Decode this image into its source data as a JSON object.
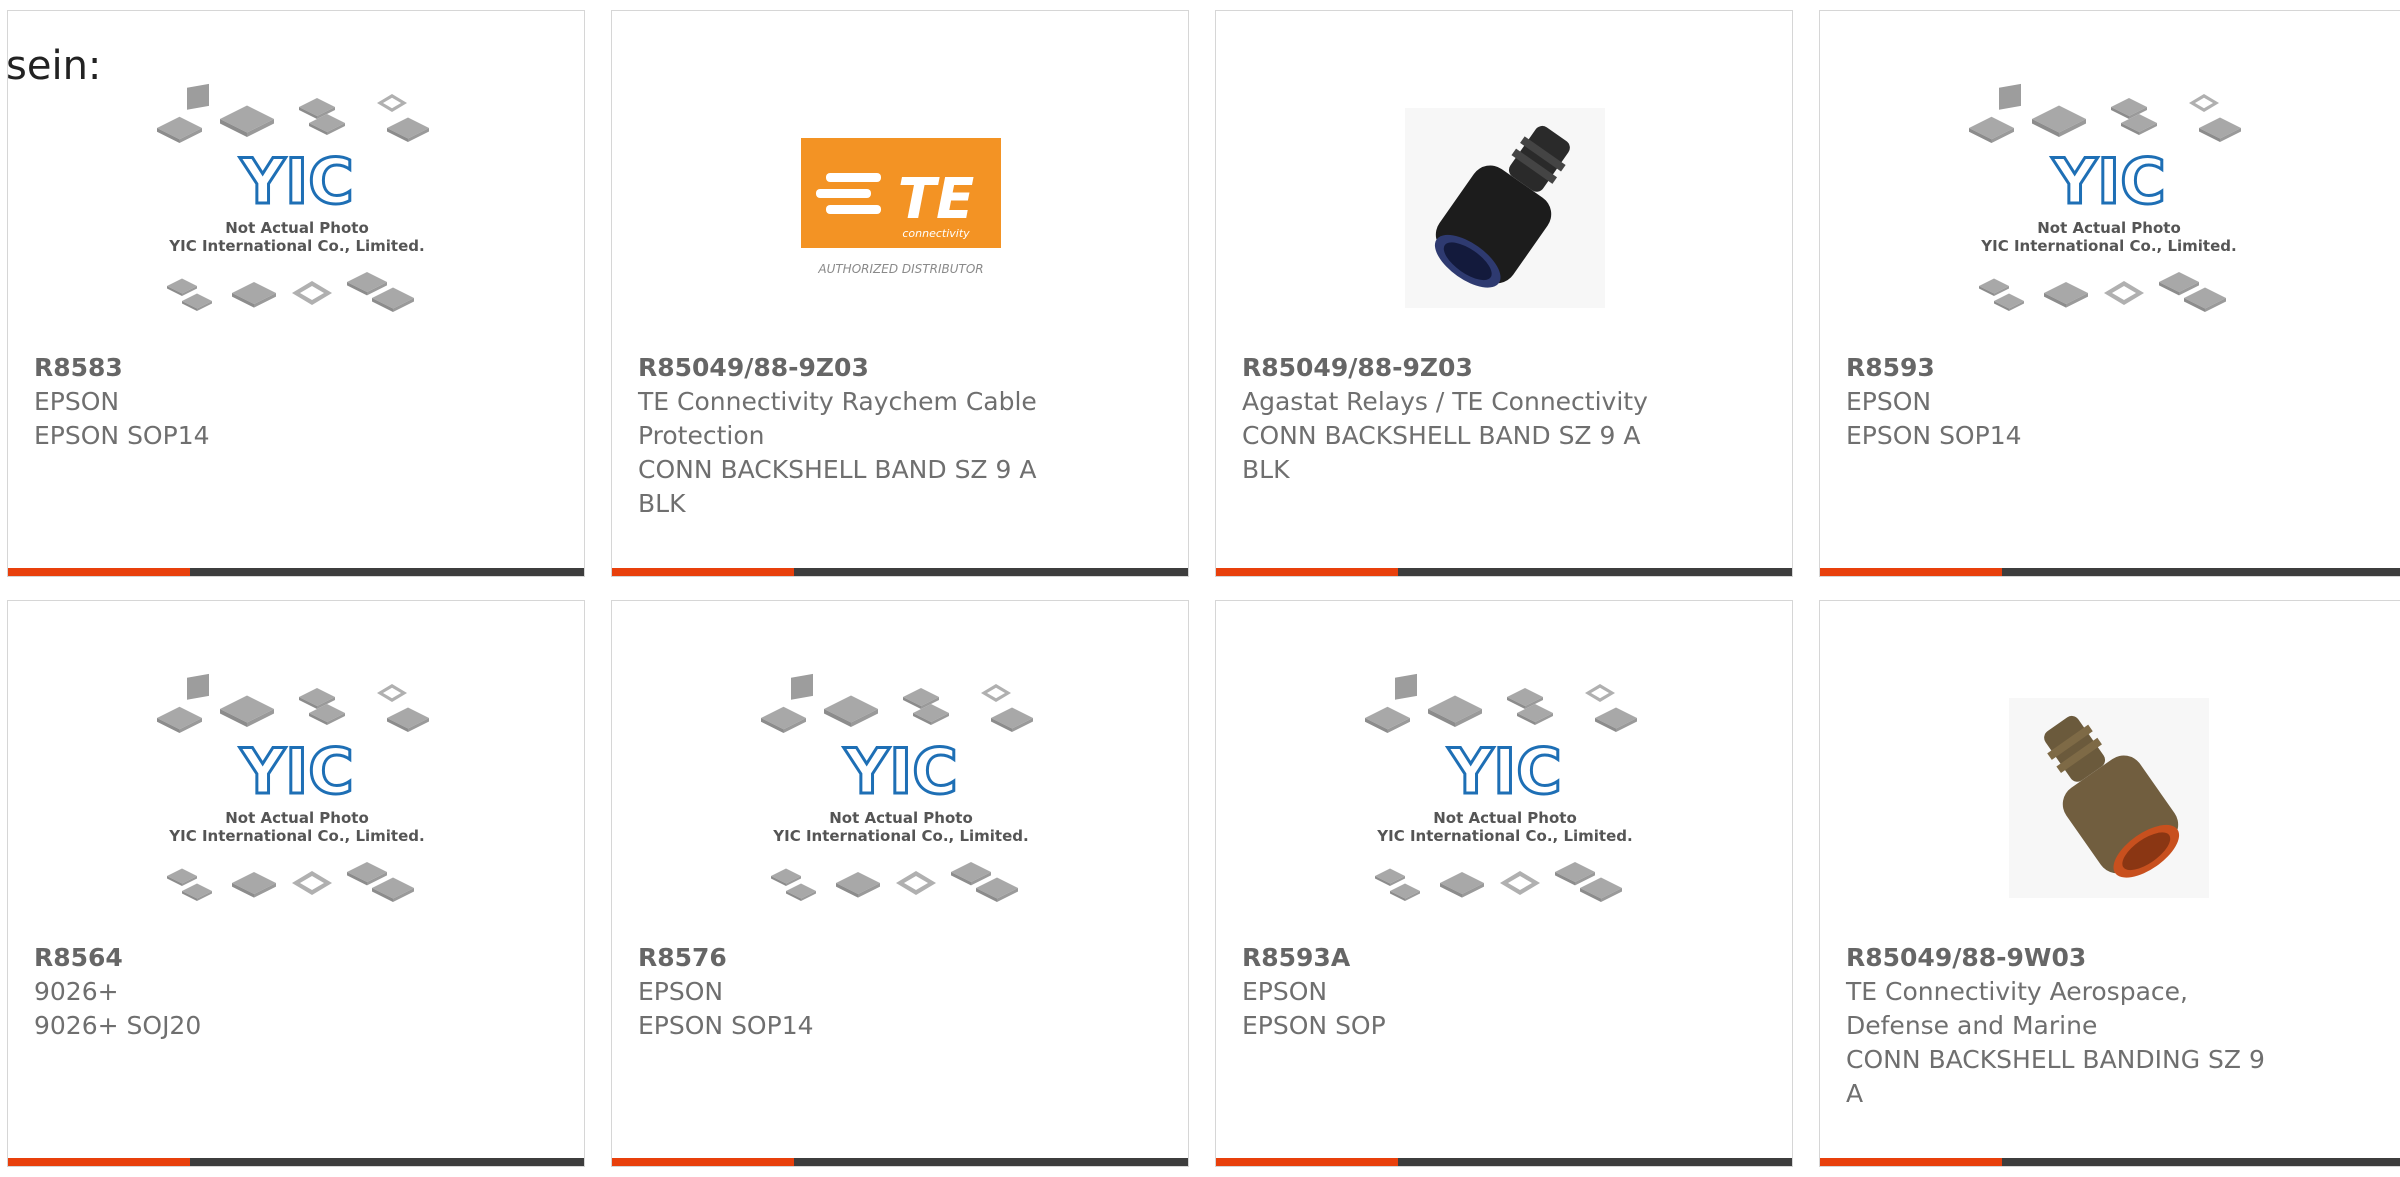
{
  "page": {
    "heading_fragment": "sein:"
  },
  "placeholder": {
    "line1": "Not Actual Photo",
    "line2": "YIC International Co., Limited.",
    "logo": "YIC"
  },
  "te_logo": {
    "mark": "TE",
    "sub": "connectivity",
    "caption": "AUTHORIZED DISTRIBUTOR",
    "color": "#f39324"
  },
  "colors": {
    "accent": "#e8400c",
    "bar": "#3d3d3d",
    "yic_blue": "#1e6fb5"
  },
  "products": [
    {
      "part": "R8583",
      "brand": "EPSON",
      "desc": "EPSON SOP14",
      "image": "yic-placeholder"
    },
    {
      "part": "R85049/88-9Z03",
      "brand": "TE Connectivity Raychem Cable Protection",
      "desc": "CONN BACKSHELL BAND SZ 9 A BLK",
      "image": "te-logo"
    },
    {
      "part": "R85049/88-9Z03",
      "brand": "Agastat Relays / TE Connectivity",
      "desc": "CONN BACKSHELL BAND SZ 9 A BLK",
      "image": "black-backshell-photo"
    },
    {
      "part": "R8593",
      "brand": "EPSON",
      "desc": "EPSON SOP14",
      "image": "yic-placeholder"
    },
    {
      "part": "R8564",
      "brand": "9026+",
      "desc": "9026+ SOJ20",
      "image": "yic-placeholder"
    },
    {
      "part": "R8576",
      "brand": "EPSON",
      "desc": "EPSON SOP14",
      "image": "yic-placeholder"
    },
    {
      "part": "R8593A",
      "brand": "EPSON",
      "desc": "EPSON SOP",
      "image": "yic-placeholder"
    },
    {
      "part": "R85049/88-9W03",
      "brand": "TE Connectivity Aerospace, Defense and Marine",
      "desc": "CONN BACKSHELL BANDING SZ 9 A",
      "image": "bronze-backshell-photo"
    }
  ]
}
